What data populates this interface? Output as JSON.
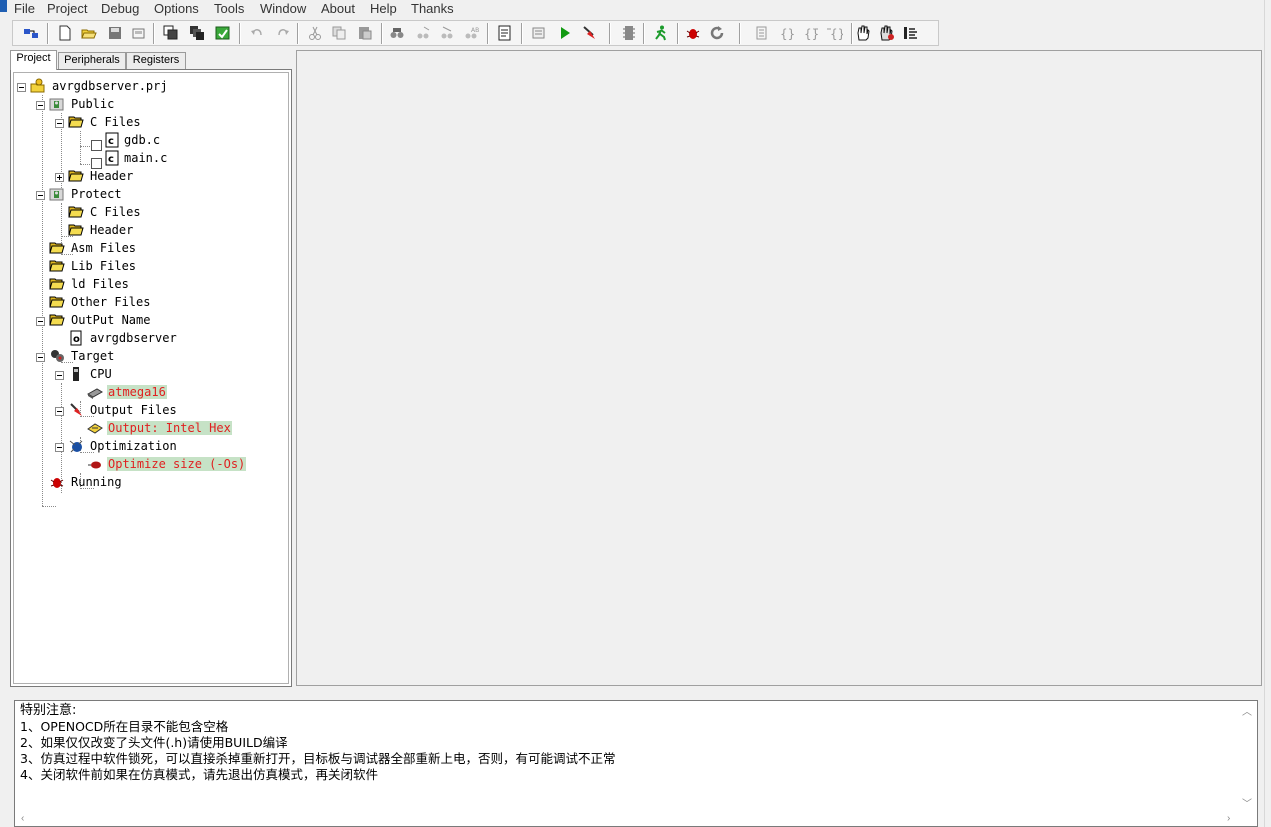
{
  "menu": {
    "items": [
      "File",
      "Project",
      "Debug",
      "Options",
      "Tools",
      "Window",
      "About",
      "Help",
      "Thanks"
    ]
  },
  "toolbar": {
    "icons": [
      "build-all-icon",
      "new-file-icon",
      "open-file-icon",
      "save-icon",
      "save-all-icon",
      "copy-window-icon",
      "cascade-icon",
      "export-icon",
      "undo-icon",
      "redo-icon",
      "cut-icon",
      "copy-icon",
      "paste-icon",
      "find-icon",
      "find-next-icon",
      "replace-icon",
      "find-in-files-icon",
      "compile-icon",
      "build-icon",
      "run-icon",
      "debug-start-icon",
      "chip-icon",
      "runner-icon",
      "bug-icon",
      "reset-icon",
      "step-into-icon",
      "step-over-icon",
      "step-out-icon",
      "run-to-cursor-icon",
      "hand-icon",
      "multi-hand-icon",
      "disassembly-icon"
    ]
  },
  "tabs": [
    "Project",
    "Peripherals",
    "Registers"
  ],
  "tree": {
    "root": "avrgdbserver.prj",
    "public": "Public",
    "public_cfiles": "C Files",
    "file_gdb": "gdb.c",
    "file_main": "main.c",
    "public_header": "Header",
    "protect": "Protect",
    "protect_cfiles": "C Files",
    "protect_header": "Header",
    "asm": "Asm Files",
    "lib": "Lib Files",
    "ld": "ld Files",
    "other": "Other Files",
    "output_name": "OutPut Name",
    "output_value": "avrgdbserver",
    "target": "Target",
    "cpu": "CPU",
    "cpu_value": "atmega16",
    "output_files": "Output Files",
    "output_files_value": "Output: Intel Hex",
    "optimization": "Optimization",
    "optimization_value": "Optimize size (-Os)",
    "running": "Running"
  },
  "output": {
    "title": "特别注意:",
    "lines": [
      "1、OPENOCD所在目录不能包含空格",
      "2、如果仅仅改变了头文件(.h)请使用BUILD编译",
      "3、仿真过程中软件锁死，可以直接杀掉重新打开，目标板与调试器全部重新上电，否则，有可能调试不正常",
      "4、关闭软件前如果在仿真模式，请先退出仿真模式，再关闭软件"
    ]
  },
  "colors": {
    "highlight_bg": "#c6e2c6",
    "highlight_text": "#e02020",
    "folder": "#f2d23c"
  }
}
